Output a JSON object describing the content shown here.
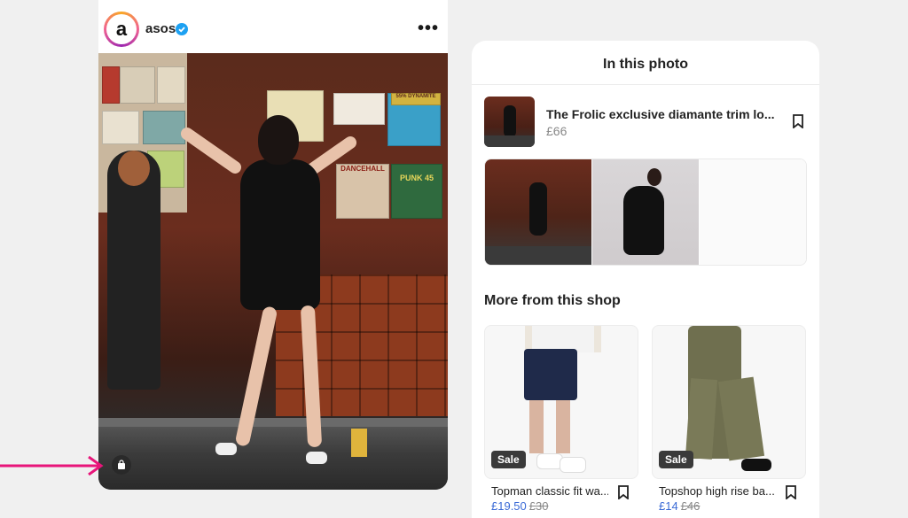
{
  "post": {
    "username": "asos",
    "avatar_letter": "a",
    "verified_icon": "verified-badge-icon",
    "more_icon": "more-dots-icon",
    "more_glyph": "•••",
    "photo_signs": [
      "DANCEHALL",
      "PUNK 45",
      "55% DYNAMITE"
    ],
    "shopping_icon": "shopping-bag-icon"
  },
  "panel": {
    "title": "In this photo",
    "tagged_product": {
      "name": "The Frolic exclusive diamante trim lo...",
      "price": "£66"
    },
    "section_title": "More from this shop",
    "products": [
      {
        "name": "Topman classic fit wa...",
        "price_now": "£19.50",
        "price_was": "£30",
        "badge": "Sale"
      },
      {
        "name": "Topshop high rise ba...",
        "price_now": "£14",
        "price_was": "£46",
        "badge": "Sale"
      }
    ]
  },
  "colors": {
    "accent_arrow": "#e8157a",
    "sale_price": "#3a6ad6",
    "verified": "#1da1f2"
  }
}
